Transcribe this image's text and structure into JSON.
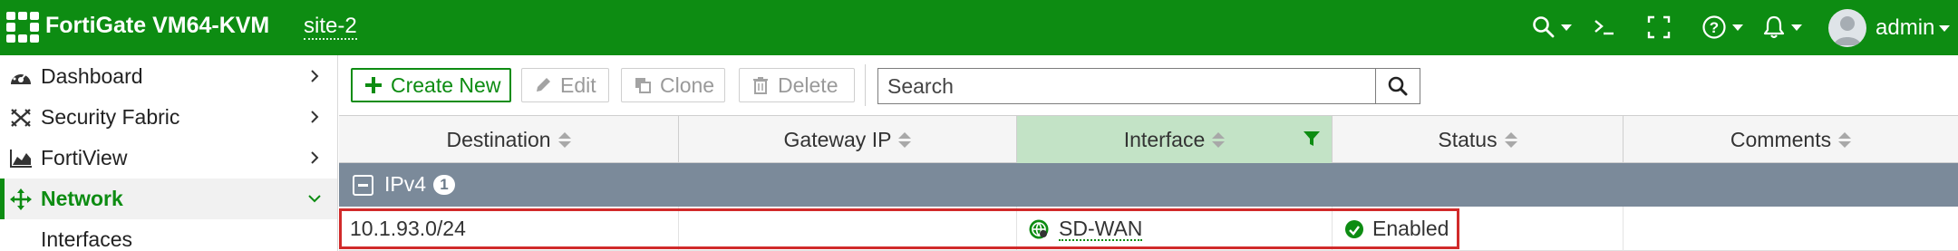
{
  "header": {
    "app_title": "FortiGate VM64-KVM",
    "vdom": "site-2",
    "user": "admin",
    "icons": [
      "search-icon",
      "cli-console-icon",
      "fullscreen-icon",
      "help-icon",
      "notifications-bell-icon",
      "user-avatar-icon"
    ],
    "brand_color": "#0d8c12"
  },
  "sidebar": {
    "items": [
      {
        "label": "Dashboard",
        "icon": "dashboard-gauge-icon"
      },
      {
        "label": "Security Fabric",
        "icon": "security-fabric-icon"
      },
      {
        "label": "FortiView",
        "icon": "fortiview-chart-icon"
      },
      {
        "label": "Network",
        "icon": "network-arrows-icon",
        "active": true
      },
      {
        "label": "Interfaces",
        "submenu": true
      }
    ]
  },
  "toolbar": {
    "create_new": "Create New",
    "edit": "Edit",
    "clone": "Clone",
    "delete": "Delete",
    "search_placeholder": "Search"
  },
  "table": {
    "columns": [
      "Destination",
      "Gateway IP",
      "Interface",
      "Status",
      "Comments"
    ],
    "filtered_column": "Interface",
    "groups": [
      {
        "label": "IPv4",
        "count": "1",
        "rows": [
          {
            "destination": "10.1.93.0/24",
            "gateway": "",
            "interface": "SD-WAN",
            "status": "Enabled",
            "comments": ""
          }
        ]
      }
    ],
    "highlight_color": "#d12a2a"
  }
}
